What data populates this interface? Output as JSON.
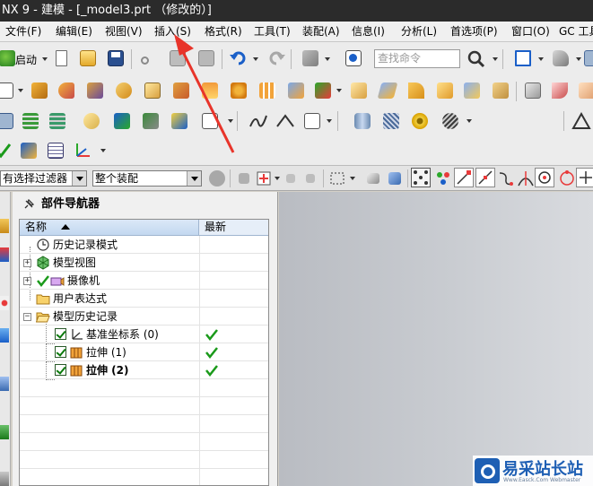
{
  "window": {
    "title": "NX 9 - 建模 - [_model3.prt （修改的）]"
  },
  "menubar": {
    "items": [
      {
        "label": "文件(F)"
      },
      {
        "label": "编辑(E)"
      },
      {
        "label": "视图(V)"
      },
      {
        "label": "插入(S)"
      },
      {
        "label": "格式(R)"
      },
      {
        "label": "工具(T)"
      },
      {
        "label": "装配(A)"
      },
      {
        "label": "信息(I)"
      },
      {
        "label": "分析(L)"
      },
      {
        "label": "首选项(P)"
      },
      {
        "label": "窗口(O)"
      },
      {
        "label": "GC 工具"
      }
    ]
  },
  "toolbar": {
    "start_label": "启动",
    "search_placeholder": "查找命令"
  },
  "selection_bar": {
    "filter_value": "有选择过滤器",
    "scope_value": "整个装配"
  },
  "navigator": {
    "title": "部件导航器",
    "columns": {
      "name": "名称",
      "recent": "最新"
    },
    "rows": [
      {
        "label": "历史记录模式",
        "bold": false
      },
      {
        "label": "模型视图",
        "bold": false
      },
      {
        "label": "摄像机",
        "bold": false
      },
      {
        "label": "用户表达式",
        "bold": false
      },
      {
        "label": "模型历史记录",
        "bold": false
      },
      {
        "label": "基准坐标系 (0)",
        "bold": false
      },
      {
        "label": "拉伸 (1)",
        "bold": false
      },
      {
        "label": "拉伸 (2)",
        "bold": true
      }
    ]
  },
  "watermark": {
    "text": "易采站长站",
    "sub": "Www.Easck.Com Webmaster"
  },
  "colors": {
    "title_bar": "#2b2b2b",
    "accent_green": "#1a9a1a",
    "arrow_red": "#e8342a",
    "viewport": "#c4c7cc"
  }
}
